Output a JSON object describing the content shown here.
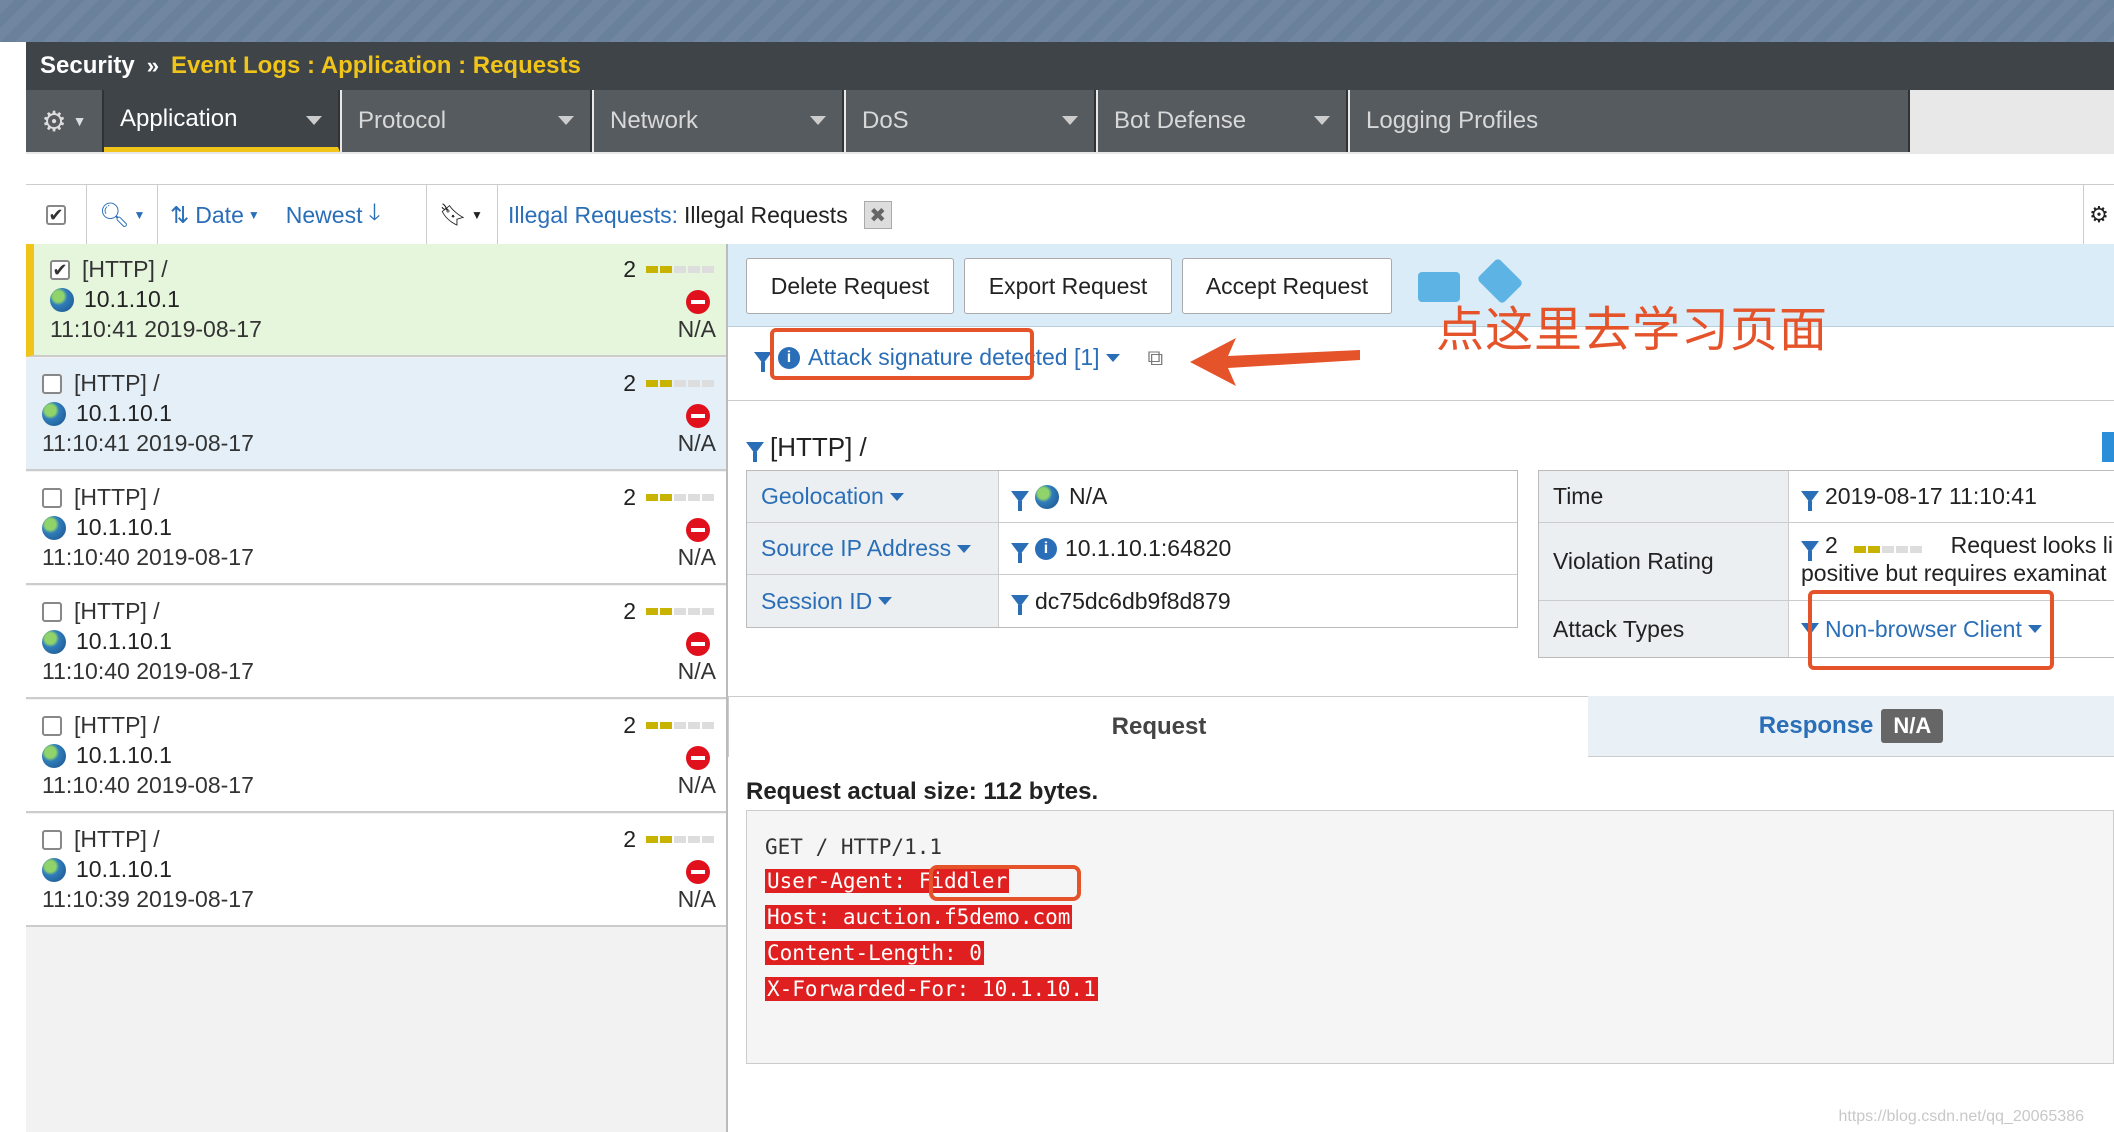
{
  "header": {
    "section": "Security",
    "separator": "»",
    "breadcrumb": "Event Logs : Application : Requests"
  },
  "tabs": [
    {
      "label": "Application"
    },
    {
      "label": "Protocol"
    },
    {
      "label": "Network"
    },
    {
      "label": "DoS"
    },
    {
      "label": "Bot Defense"
    },
    {
      "label": "Logging Profiles"
    }
  ],
  "toolbar": {
    "sort_label": "Date",
    "order_label": "Newest",
    "filter_prefix": "Illegal Requests:",
    "filter_value": "Illegal Requests"
  },
  "requests": [
    {
      "title": "[HTTP] /",
      "ip": "10.1.10.1",
      "time": "11:10:41 2019-08-17",
      "rating": "2",
      "status": "N/A"
    },
    {
      "title": "[HTTP] /",
      "ip": "10.1.10.1",
      "time": "11:10:41 2019-08-17",
      "rating": "2",
      "status": "N/A"
    },
    {
      "title": "[HTTP] /",
      "ip": "10.1.10.1",
      "time": "11:10:40 2019-08-17",
      "rating": "2",
      "status": "N/A"
    },
    {
      "title": "[HTTP] /",
      "ip": "10.1.10.1",
      "time": "11:10:40 2019-08-17",
      "rating": "2",
      "status": "N/A"
    },
    {
      "title": "[HTTP] /",
      "ip": "10.1.10.1",
      "time": "11:10:40 2019-08-17",
      "rating": "2",
      "status": "N/A"
    },
    {
      "title": "[HTTP] /",
      "ip": "10.1.10.1",
      "time": "11:10:39 2019-08-17",
      "rating": "2",
      "status": "N/A"
    }
  ],
  "actions": {
    "delete": "Delete Request",
    "export": "Export Request",
    "accept": "Accept Request"
  },
  "annotation": "点这里去学习页面",
  "signature_link": "Attack signature detected [1]",
  "request_title": "[HTTP] /",
  "details_left": [
    {
      "label": "Geolocation",
      "value": "N/A"
    },
    {
      "label": "Source IP Address",
      "value": "10.1.10.1:64820"
    },
    {
      "label": "Session ID",
      "value": "dc75dc6db9f8d879"
    }
  ],
  "details_right": {
    "time_label": "Time",
    "time_value": "2019-08-17 11:10:41",
    "rating_label": "Violation Rating",
    "rating_value": "2",
    "rating_desc_1": "Request looks li",
    "rating_desc_2": "positive but requires examinat",
    "attack_label": "Attack Types",
    "attack_value": "Non-browser Client"
  },
  "panel_tabs": {
    "request": "Request",
    "response": "Response",
    "response_badge": "N/A"
  },
  "request_size": "Request actual size: 112 bytes.",
  "request_lines": [
    "GET / HTTP/1.1",
    "User-Agent: Fiddler",
    "Host: auction.f5demo.com",
    "Content-Length: 0",
    "X-Forwarded-For: 10.1.10.1"
  ],
  "watermark": "https://blog.csdn.net/qq_20065386",
  "colors": {
    "accent": "#f0c419",
    "link": "#2a6eb8",
    "highlight": "#e02020",
    "annotation": "#e5532a"
  }
}
